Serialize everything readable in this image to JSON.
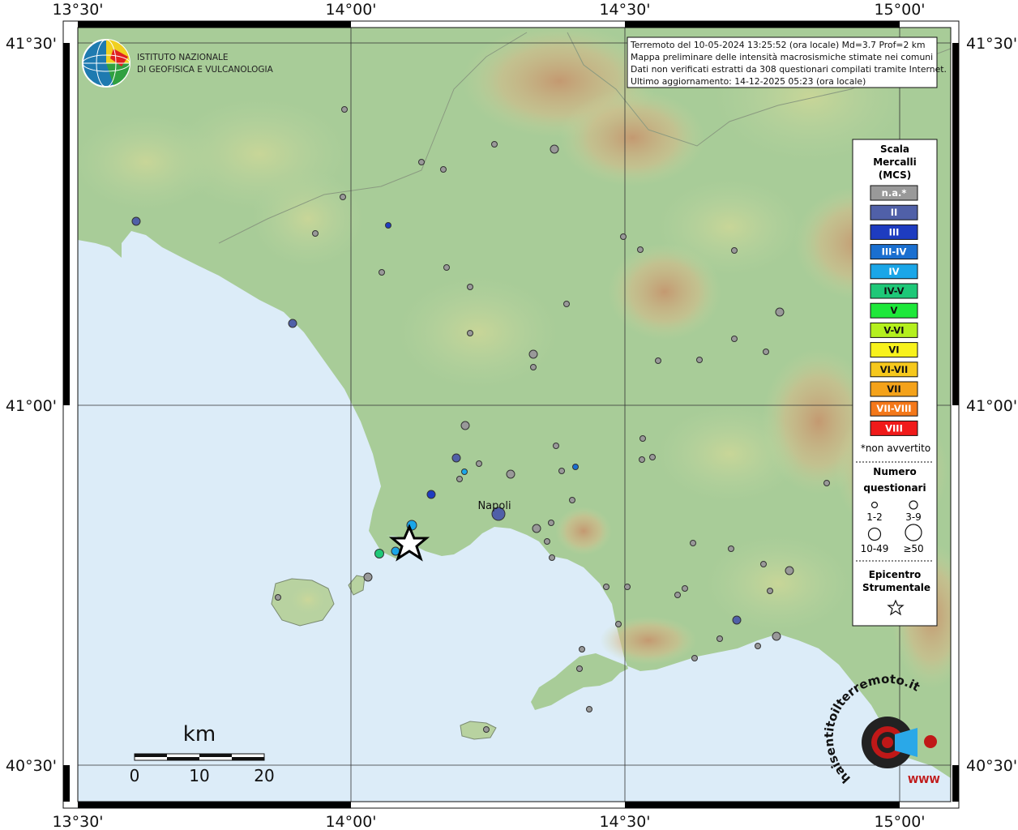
{
  "info_box": [
    "Terremoto del 10-05-2024 13:25:52 (ora locale) Md=3.7 Prof=2 km",
    "Mappa preliminare delle intensità macrosismiche stimate nei comuni",
    "Dati non verificati estratti da 308 questionari compilati tramite Internet.",
    "Ultimo aggiornamento: 14-12-2025 05:23 (ora locale)"
  ],
  "logo": {
    "line1": "ISTITUTO NAZIONALE",
    "line2": "DI GEOFISICA E VULCANOLOGIA"
  },
  "axes": {
    "lon_top": [
      "13°30'",
      "14°00'",
      "14°30'",
      "15°00'"
    ],
    "lon_bottom": [
      "13°30'",
      "14°00'",
      "14°30'",
      "15°00'"
    ],
    "lat_left": [
      "41°30'",
      "41°00'",
      "40°30'"
    ],
    "lat_right": [
      "41°30'",
      "41°00'",
      "40°30'"
    ]
  },
  "city_label": "Napoli",
  "scale_bar": {
    "unit": "km",
    "ticks": [
      "0",
      "10",
      "20"
    ]
  },
  "legend": {
    "title": [
      "Scala",
      "Mercalli",
      "(MCS)"
    ],
    "classes": [
      {
        "label": "n.a.*",
        "color": "#999999"
      },
      {
        "label": "II",
        "color": "#5060a8"
      },
      {
        "label": "III",
        "color": "#1e3cc0"
      },
      {
        "label": "III-IV",
        "color": "#1a6fd0"
      },
      {
        "label": "IV",
        "color": "#1aa6e8"
      },
      {
        "label": "IV-V",
        "color": "#1ec878"
      },
      {
        "label": "V",
        "color": "#1ee83a"
      },
      {
        "label": "V-VI",
        "color": "#b4f01e"
      },
      {
        "label": "VI",
        "color": "#f8f21c"
      },
      {
        "label": "VI-VII",
        "color": "#f6c81c"
      },
      {
        "label": "VII",
        "color": "#f4a21a"
      },
      {
        "label": "VII-VIII",
        "color": "#f4781a"
      },
      {
        "label": "VIII",
        "color": "#f01a1a"
      }
    ],
    "not_felt_note": "*non avvertito",
    "count_title": [
      "Numero",
      "questionari"
    ],
    "count_sizes": [
      "1-2",
      "3-9",
      "10-49",
      "≥50"
    ],
    "epicenter_title": [
      "Epicentro",
      "Strumentale"
    ]
  },
  "watermark": {
    "text": "haisentitoilterremoto.it",
    "prefix": "WWW"
  },
  "colors": {
    "sea": "#dcecf8",
    "land": "#a8cc98",
    "mountain": "#d8a878",
    "grid": "#222222"
  }
}
